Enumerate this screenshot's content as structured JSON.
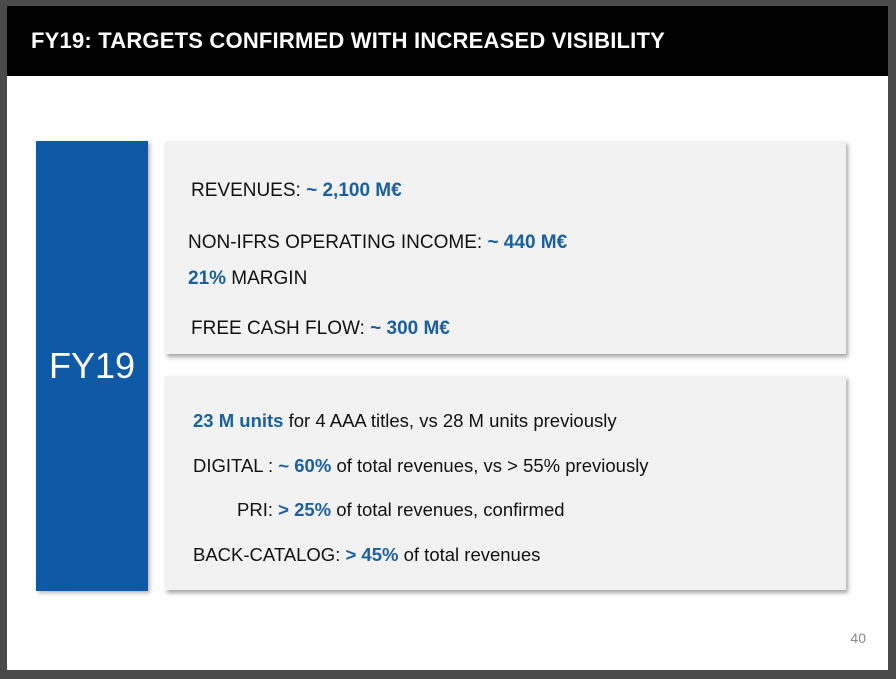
{
  "slide": {
    "title": "FY19: TARGETS CONFIRMED WITH INCREASED VISIBILITY",
    "sidebar_label": "FY19",
    "page_number": "40"
  },
  "financial_targets": {
    "revenues_label": "REVENUES: ",
    "revenues_value": "~ 2,100 M€",
    "operating_income_label": "NON-IFRS OPERATING INCOME: ",
    "operating_income_value": "~ 440 M€",
    "margin_value": "21%",
    "margin_label": " MARGIN",
    "fcf_label": "FREE CASH FLOW: ",
    "fcf_value": "~ 300 M€"
  },
  "operational_targets": {
    "units_value": "23 M units",
    "units_text": " for 4 AAA titles, vs 28 M units previously",
    "digital_label": "DIGITAL : ",
    "digital_value": "~ 60%",
    "digital_text": " of total revenues, vs > 55% previously",
    "pri_label": "PRI: ",
    "pri_value": "> 25%",
    "pri_text": " of total revenues, confirmed",
    "backcatalog_label": "BACK-CATALOG: ",
    "backcatalog_value": "> 45%",
    "backcatalog_text": " of total revenues"
  },
  "colors": {
    "highlight": "#1a5f9e",
    "sidebar": "#0e5aa7",
    "title_bar": "#000000",
    "panel": "#f2f2f2"
  }
}
